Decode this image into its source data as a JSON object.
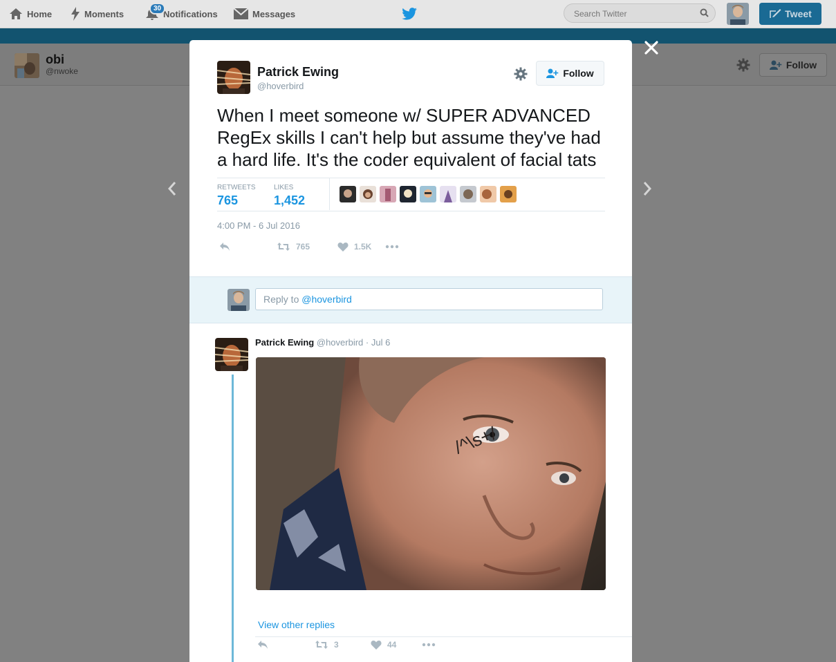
{
  "nav": {
    "home": "Home",
    "moments": "Moments",
    "notifications": "Notifications",
    "notifications_badge": "30",
    "messages": "Messages",
    "search_placeholder": "Search Twitter",
    "tweet_button": "Tweet"
  },
  "profile": {
    "name": "obi",
    "handle": "@nwoke",
    "follow_label": "Follow"
  },
  "tweet": {
    "author_name": "Patrick Ewing",
    "author_handle": "@hoverbird",
    "follow_label": "Follow",
    "text": "When I meet someone w/ SUPER ADVANCED RegEx skills I can't help but assume they've had a hard life. It's the coder equivalent of facial tats",
    "retweets_label": "RETWEETS",
    "retweets_count": "765",
    "likes_label": "LIKES",
    "likes_count": "1,452",
    "timestamp": "4:00 PM - 6 Jul 2016",
    "action_retweets": "765",
    "action_likes": "1.5K"
  },
  "reply_box": {
    "prefix": "Reply to ",
    "mention": "@hoverbird"
  },
  "reply_tweet": {
    "author_name": "Patrick Ewing",
    "author_handle": "@hoverbird",
    "separator": "·",
    "date": "Jul 6",
    "tattoo_text": "/^\\s+/",
    "retweets": "3",
    "likes": "44",
    "view_other_replies": "View other replies"
  },
  "colors": {
    "twitter_blue": "#1b95e0",
    "nav_bar": "#e6e6e6",
    "accent_bar": "#12536f",
    "reply_box_bg": "#e8f4f9",
    "thread_line": "#6db8d8"
  },
  "icons": [
    "home-icon",
    "moments-icon",
    "notifications-icon",
    "messages-icon",
    "twitter-bird-icon",
    "search-icon",
    "compose-icon",
    "gear-icon",
    "follow-person-icon",
    "close-icon",
    "chevron-left-icon",
    "chevron-right-icon",
    "reply-icon",
    "retweet-icon",
    "heart-icon",
    "more-icon"
  ]
}
